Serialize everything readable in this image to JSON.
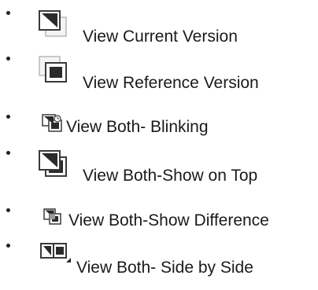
{
  "view_options": [
    {
      "label": "View Current Version",
      "icon": "view-current-icon"
    },
    {
      "label": "View Reference Version",
      "icon": "view-reference-icon"
    },
    {
      "label": "View Both- Blinking",
      "icon": "view-blinking-icon"
    },
    {
      "label": "View Both-Show on Top",
      "icon": "view-show-on-top-icon"
    },
    {
      "label": "View Both-Show Difference",
      "icon": "view-show-difference-icon"
    },
    {
      "label": "View Both- Side by Side",
      "icon": "view-side-by-side-icon"
    }
  ]
}
